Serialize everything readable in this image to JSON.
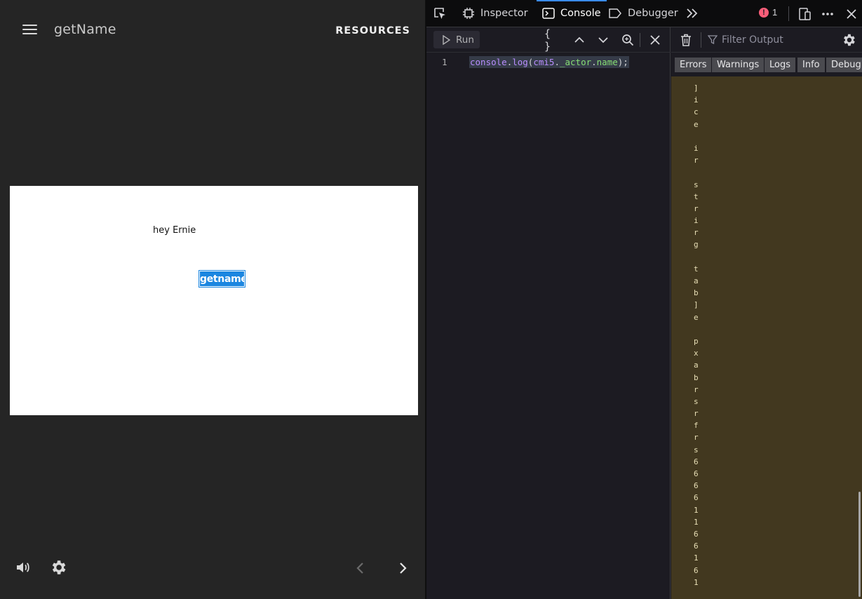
{
  "player": {
    "title": "getName",
    "resources_label": "RESOURCES",
    "slide": {
      "greeting": "hey Ernie",
      "button_label": "getname"
    }
  },
  "devtools": {
    "tabs": {
      "inspector": "Inspector",
      "console": "Console",
      "debugger": "Debugger"
    },
    "error_count": "1",
    "editor": {
      "run_label": "Run",
      "pretty_print": "{ }",
      "line_number": "1",
      "code": {
        "obj": "console",
        "method": "log",
        "arg_obj": "cmi5",
        "arg_prop1": "_actor",
        "arg_prop2": "name"
      }
    },
    "output": {
      "filter_placeholder": "Filter Output",
      "filters": [
        "Errors",
        "Warnings",
        "Logs",
        "Info",
        "Debug"
      ],
      "log_chars": [
        "]",
        "i",
        "c",
        "e",
        "",
        "i",
        "r",
        "",
        "s",
        "t",
        "r",
        "i",
        "r",
        "g",
        "",
        "t",
        "a",
        "b",
        "]",
        "e",
        "",
        "p",
        "x",
        "a",
        "b",
        "r",
        "s",
        "r",
        "f",
        "r",
        "s",
        "6",
        "6",
        "6",
        "6",
        "1",
        "1",
        "6",
        "6",
        "1",
        "6",
        "1"
      ]
    }
  }
}
